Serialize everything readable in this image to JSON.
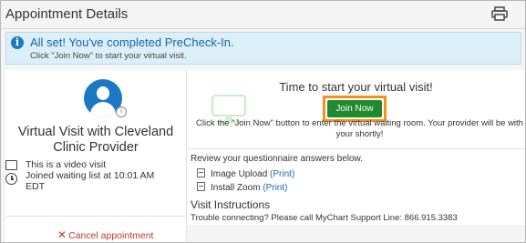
{
  "header": {
    "title": "Appointment Details",
    "print_icon": "printer-icon"
  },
  "banner": {
    "icon": "info-icon",
    "title": "All set! You've completed PreCheck-In.",
    "subtitle": "Click \"Join Now\" to start your virtual visit."
  },
  "left": {
    "avatar_icon": "provider-avatar",
    "provider_name": "Virtual Visit with Cleveland Clinic Provider",
    "video_text": "This is a video visit",
    "waiting_text": "Joined waiting list at 10:01 AM EDT",
    "cancel_label": "Cancel appointment"
  },
  "right": {
    "start_title": "Time to start your virtual visit!",
    "join_label": "Join Now",
    "join_desc": "Click the \"Join Now\" button to enter the virtual waiting room. Your provider will be with your shortly!",
    "review_text": "Review your questionnaire answers below.",
    "questionnaires": [
      {
        "label": "Image Upload",
        "link": "(Print)"
      },
      {
        "label": "Install Zoom",
        "link": "(Print)"
      }
    ],
    "visit_title": "Visit Instructions",
    "visit_text": "Trouble connecting? Please call MyChart Support Line: 866.915.3383"
  },
  "colors": {
    "accent": "#1b7bbf",
    "join_button": "#1f8a2e",
    "highlight": "#f5921e",
    "cancel": "#c0392b"
  }
}
